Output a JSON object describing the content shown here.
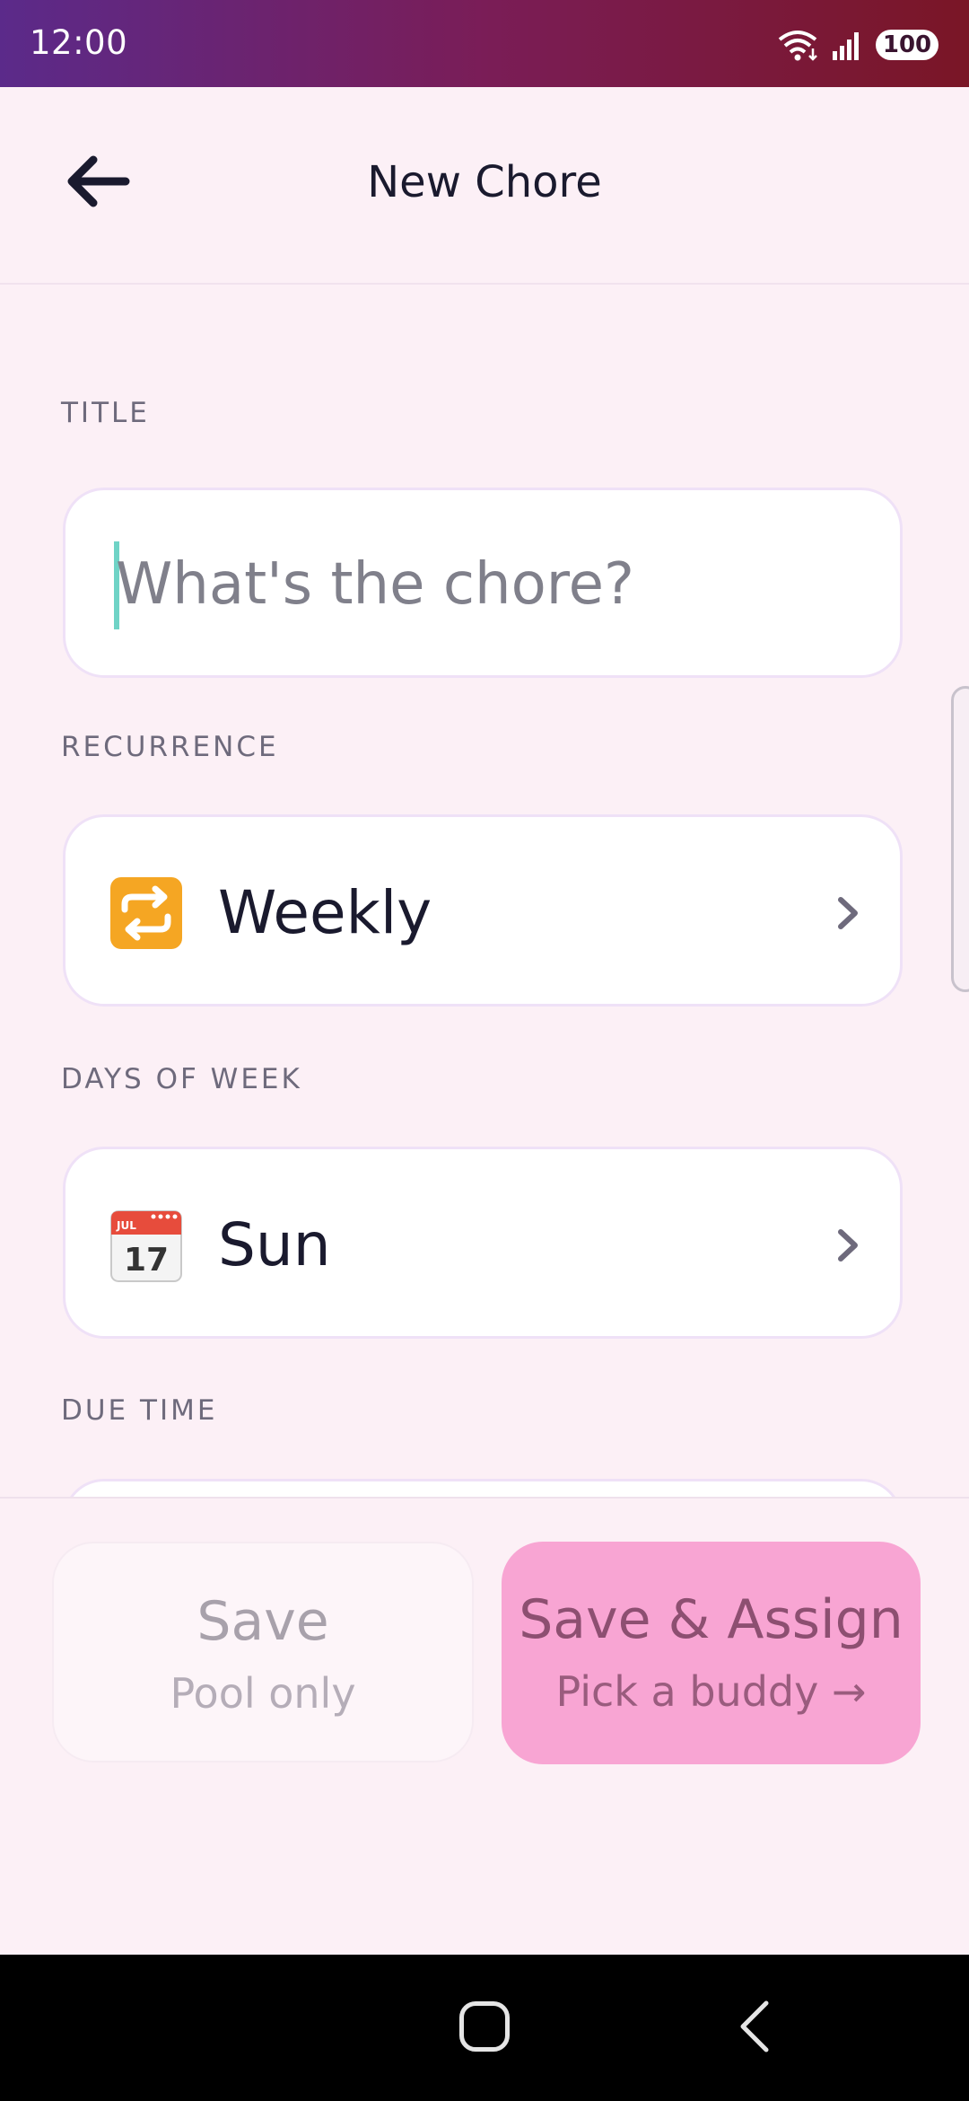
{
  "status_bar": {
    "time": "12:00",
    "battery": "100"
  },
  "header": {
    "title": "New Chore"
  },
  "form": {
    "title_label": "TITLE",
    "title_value": "",
    "title_placeholder": "What's the chore?",
    "recurrence_label": "RECURRENCE",
    "recurrence_value": "Weekly",
    "recurrence_icon": "repeat-icon",
    "days_label": "DAYS OF WEEK",
    "days_value": "Sun",
    "days_icon": "calendar-icon",
    "calendar_month": "JUL",
    "calendar_day": "17",
    "due_time_label": "DUE TIME"
  },
  "footer": {
    "save_label": "Save",
    "save_sub": "Pool only",
    "assign_label": "Save & Assign",
    "assign_sub": "Pick a buddy →"
  },
  "colors": {
    "background": "#fcf0f6",
    "accent_pink": "#f8a5d3",
    "caret": "#6fd3c6"
  }
}
